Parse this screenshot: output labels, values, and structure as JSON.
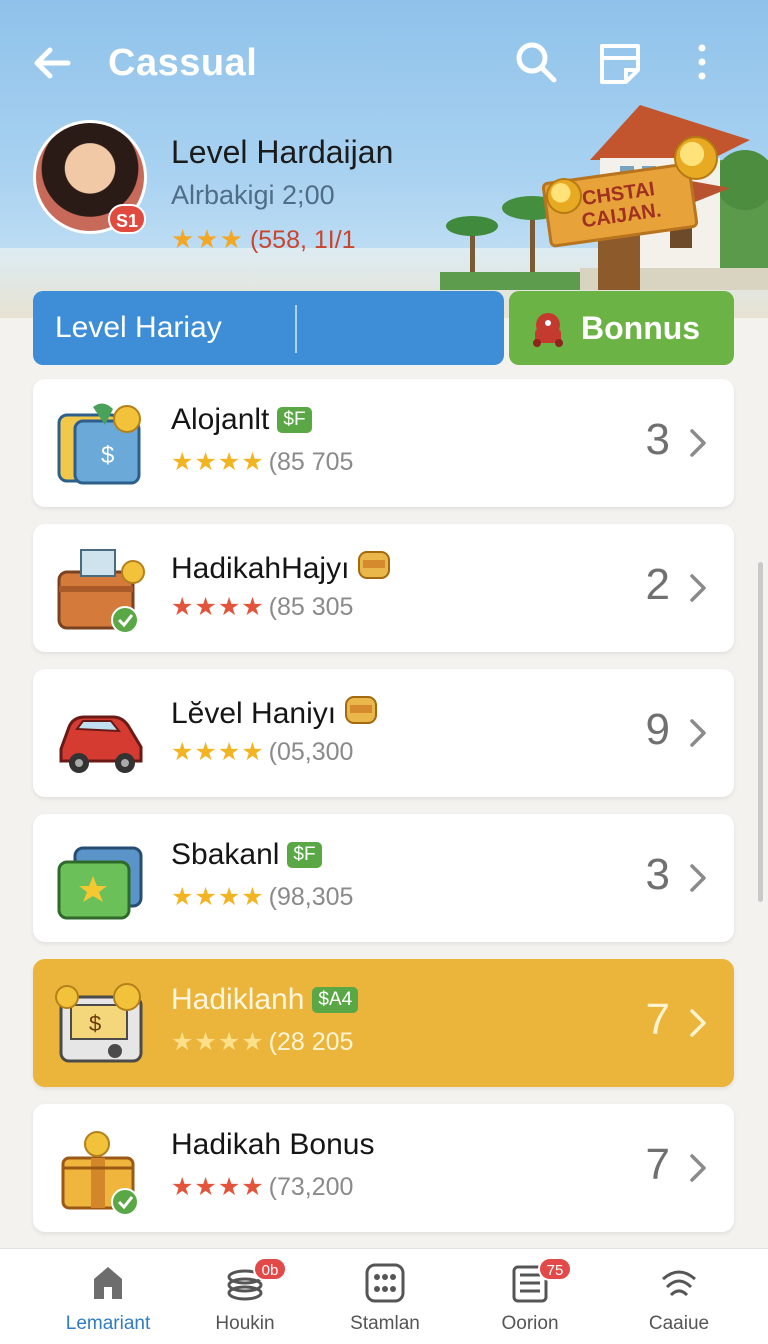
{
  "header": {
    "title": "Cassual",
    "back_icon": "arrow-left-icon",
    "search_icon": "search-icon",
    "notes_icon": "note-icon",
    "menu_icon": "more-vertical-icon"
  },
  "profile": {
    "name": "Level Hardaijan",
    "subtitle": "Alrbakigi 2;00",
    "stars": "★★★",
    "rating_text": "(558, 1I/1",
    "avatar_badge": "S1",
    "sign_text": "CHSTAI CAIJAN."
  },
  "tabs": {
    "level_label": "Level Hariay",
    "bonus_label": "Bonnus"
  },
  "items": [
    {
      "title": "Alojanlt",
      "tag": "$F",
      "tag_type": "money",
      "stars": "★★★★",
      "star_color": "gold",
      "rating": "(85 705",
      "count": "3",
      "icon": "wallet-icon"
    },
    {
      "title": "HadikahHajyı",
      "tag": "",
      "tag_type": "coin",
      "stars": "★★★★",
      "star_color": "red",
      "rating": "(85 305",
      "count": "2",
      "icon": "suitcase-icon"
    },
    {
      "title": "Lĕvel Haniyı",
      "tag": "",
      "tag_type": "coin",
      "stars": "★★★★",
      "star_color": "gold",
      "rating": "(05,300",
      "count": "9",
      "icon": "car-icon"
    },
    {
      "title": "Sbakanl",
      "tag": "$F",
      "tag_type": "money",
      "stars": "★★★★",
      "star_color": "gold",
      "rating": "(98,305",
      "count": "3",
      "icon": "green-wallet-icon"
    },
    {
      "title": "Hadiklanh",
      "tag": "$A4",
      "tag_type": "money",
      "stars": "★★★★",
      "star_color": "gold",
      "rating": "(28 205",
      "count": "7",
      "icon": "cash-register-icon",
      "highlight": true
    },
    {
      "title": "Hadikah Bonus",
      "tag": "",
      "tag_type": "none",
      "stars": "★★★★",
      "star_color": "red",
      "rating": "(73,200",
      "count": "7",
      "icon": "gift-box-icon"
    }
  ],
  "nav": [
    {
      "label": "Lemariant",
      "icon": "home-icon",
      "badge": "",
      "active": true
    },
    {
      "label": "Houkin",
      "icon": "coin-stack-icon",
      "badge": "0b"
    },
    {
      "label": "Stamlan",
      "icon": "grid-dots-icon",
      "badge": ""
    },
    {
      "label": "Oorion",
      "icon": "list-doc-icon",
      "badge": "75"
    },
    {
      "label": "Caaiue",
      "icon": "wifi-waves-icon",
      "badge": ""
    }
  ],
  "colors": {
    "primary_blue": "#3d8ed6",
    "bonus_green": "#6ab344",
    "highlight_gold": "#ebb43b",
    "star_gold": "#f3b424",
    "star_red": "#e2543b",
    "badge_red": "#e24a4a"
  }
}
